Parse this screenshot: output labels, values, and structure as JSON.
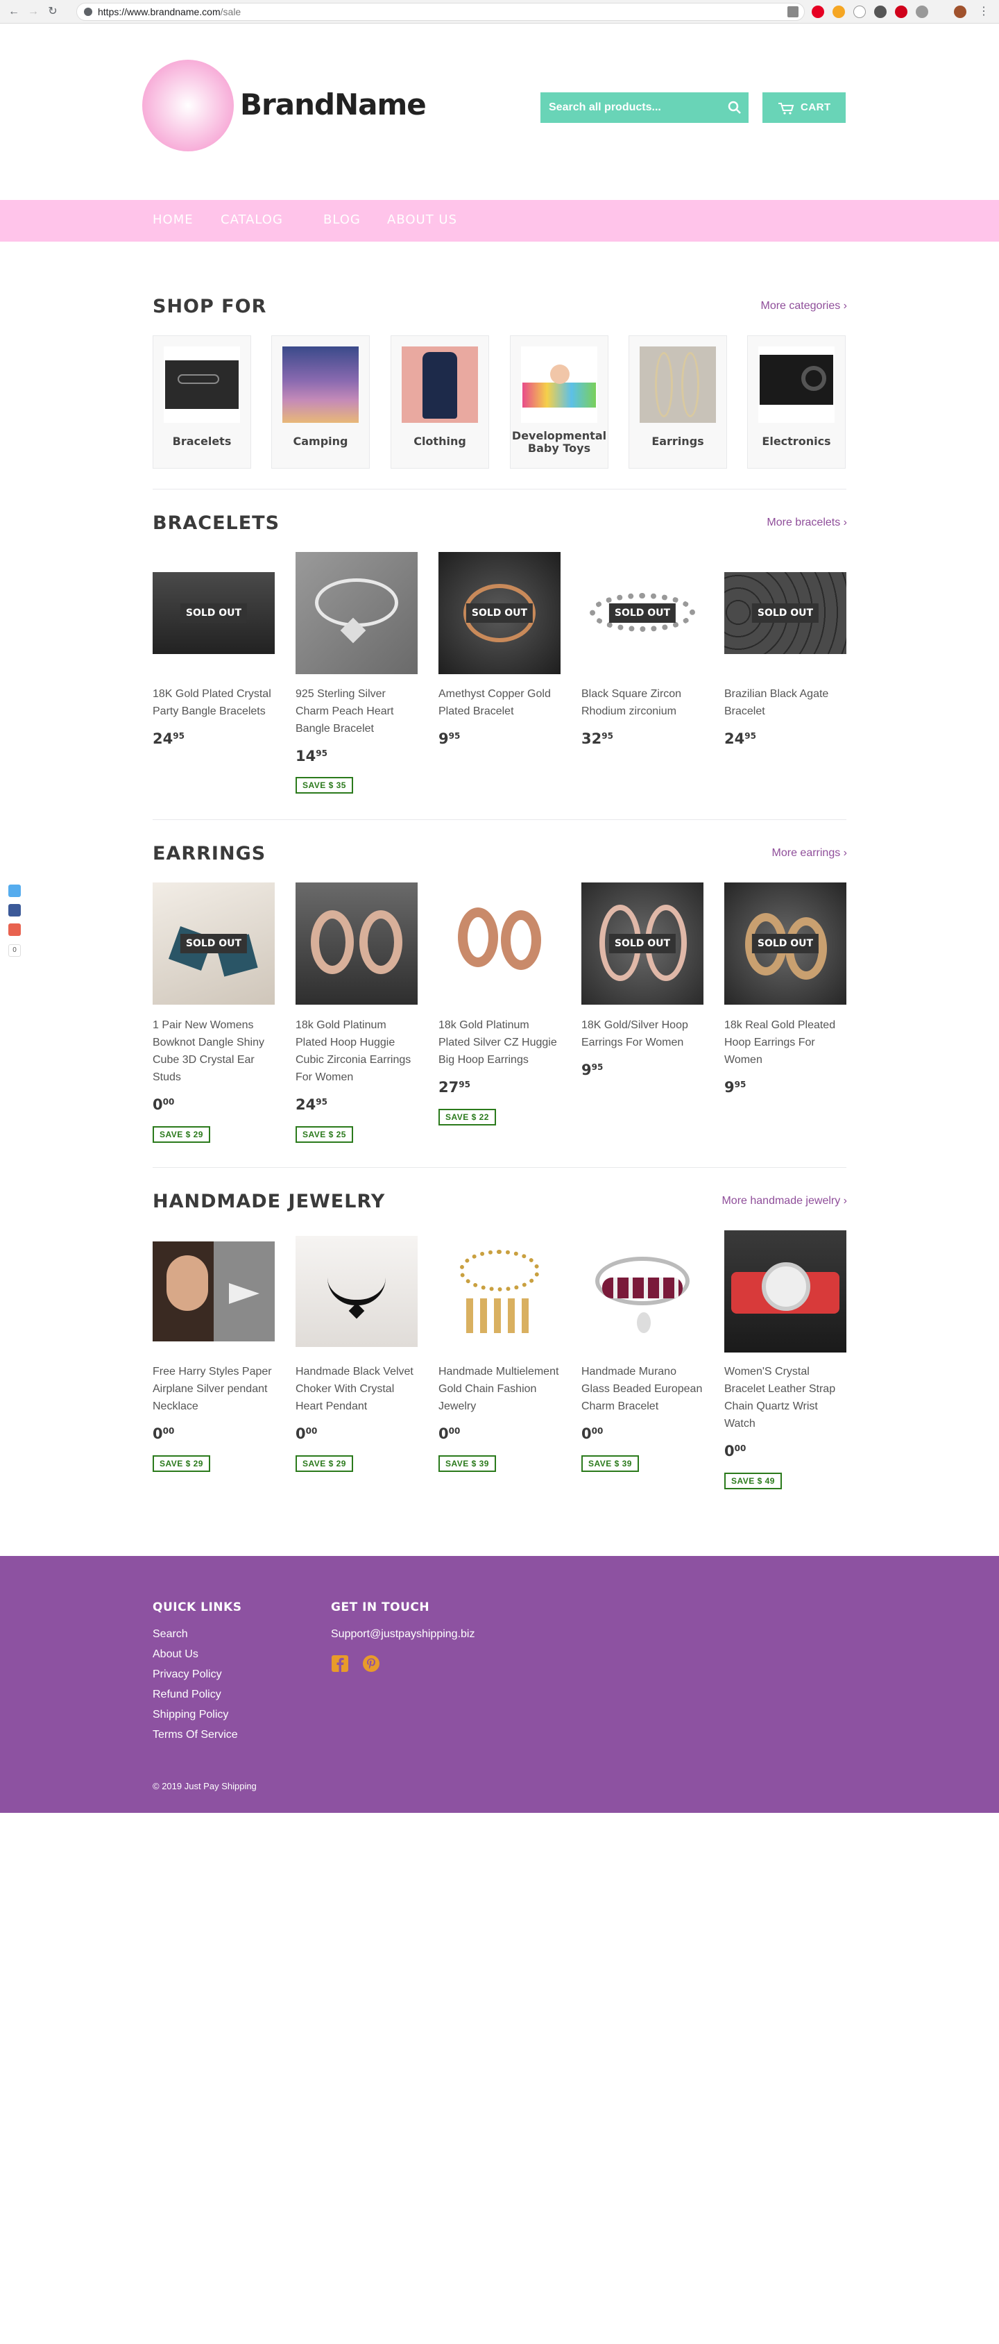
{
  "browser": {
    "url_host": "https://www.brandname.com",
    "url_path": "/sale"
  },
  "header": {
    "logo_text": "BrandName",
    "search_placeholder": "Search all products...",
    "cart_label": "CART"
  },
  "nav": {
    "items": [
      "HOME",
      "CATALOG",
      "BLOG",
      "ABOUT US"
    ]
  },
  "shop_for": {
    "title": "SHOP FOR",
    "more": "More categories ›",
    "categories": [
      {
        "label": "Bracelets"
      },
      {
        "label": "Camping"
      },
      {
        "label": "Clothing"
      },
      {
        "label": "Developmental Baby Toys"
      },
      {
        "label": "Earrings"
      },
      {
        "label": "Electronics"
      }
    ]
  },
  "bracelets": {
    "title": "BRACELETS",
    "more": "More bracelets ›",
    "products": [
      {
        "name": "18K Gold Plated Crystal Party Bangle Bracelets",
        "price_main": "24",
        "price_cents": "95",
        "save": "",
        "sold_out": "SOLD OUT"
      },
      {
        "name": "925 Sterling Silver Charm Peach Heart Bangle Bracelet",
        "price_main": "14",
        "price_cents": "95",
        "save": "SAVE $ 35",
        "sold_out": ""
      },
      {
        "name": "Amethyst Copper Gold Plated Bracelet",
        "price_main": "9",
        "price_cents": "95",
        "save": "",
        "sold_out": "SOLD OUT"
      },
      {
        "name": "Black Square Zircon Rhodium zirconium",
        "price_main": "32",
        "price_cents": "95",
        "save": "",
        "sold_out": "SOLD OUT"
      },
      {
        "name": "Brazilian Black Agate Bracelet",
        "price_main": "24",
        "price_cents": "95",
        "save": "",
        "sold_out": "SOLD OUT"
      }
    ]
  },
  "earrings": {
    "title": "EARRINGS",
    "more": "More earrings ›",
    "products": [
      {
        "name": "1 Pair New Womens Bowknot Dangle Shiny Cube 3D Crystal Ear Studs",
        "price_main": "0",
        "price_cents": "00",
        "save": "SAVE $ 29",
        "sold_out": "SOLD OUT"
      },
      {
        "name": "18k Gold Platinum Plated Hoop Huggie Cubic Zirconia Earrings For Women",
        "price_main": "24",
        "price_cents": "95",
        "save": "SAVE $ 25",
        "sold_out": ""
      },
      {
        "name": "18k Gold Platinum Plated Silver CZ Huggie Big Hoop Earrings",
        "price_main": "27",
        "price_cents": "95",
        "save": "SAVE $ 22",
        "sold_out": ""
      },
      {
        "name": "18K Gold/Silver Hoop Earrings For Women",
        "price_main": "9",
        "price_cents": "95",
        "save": "",
        "sold_out": "SOLD OUT"
      },
      {
        "name": "18k Real Gold Pleated Hoop Earrings For Women",
        "price_main": "9",
        "price_cents": "95",
        "save": "",
        "sold_out": "SOLD OUT"
      }
    ]
  },
  "handmade": {
    "title": "HANDMADE JEWELRY",
    "more": "More handmade jewelry ›",
    "products": [
      {
        "name": "Free Harry Styles Paper Airplane Silver pendant Necklace",
        "price_main": "0",
        "price_cents": "00",
        "save": "SAVE $ 29"
      },
      {
        "name": "Handmade Black Velvet Choker With Crystal Heart Pendant",
        "price_main": "0",
        "price_cents": "00",
        "save": "SAVE $ 29"
      },
      {
        "name": "Handmade Multielement Gold Chain Fashion Jewelry",
        "price_main": "0",
        "price_cents": "00",
        "save": "SAVE $ 39"
      },
      {
        "name": "Handmade Murano Glass Beaded European Charm Bracelet",
        "price_main": "0",
        "price_cents": "00",
        "save": "SAVE $ 39"
      },
      {
        "name": "Women'S Crystal Bracelet Leather Strap Chain Quartz Wrist Watch",
        "price_main": "0",
        "price_cents": "00",
        "save": "SAVE $ 49"
      }
    ]
  },
  "share": {
    "count": "0"
  },
  "footer": {
    "quick_links_title": "QUICK LINKS",
    "links": [
      "Search",
      "About Us",
      "Privacy Policy",
      "Refund Policy",
      "Shipping Policy",
      "Terms Of Service"
    ],
    "contact_title": "GET IN TOUCH",
    "email": "Support@justpayshipping.biz",
    "copyright": "© 2019 Just Pay Shipping"
  },
  "colors": {
    "accent": "#69d4b7",
    "nav": "#ffc4ea",
    "footer": "#8d52a1",
    "link": "#8f4e9a",
    "save_green": "#2b7a1c"
  }
}
